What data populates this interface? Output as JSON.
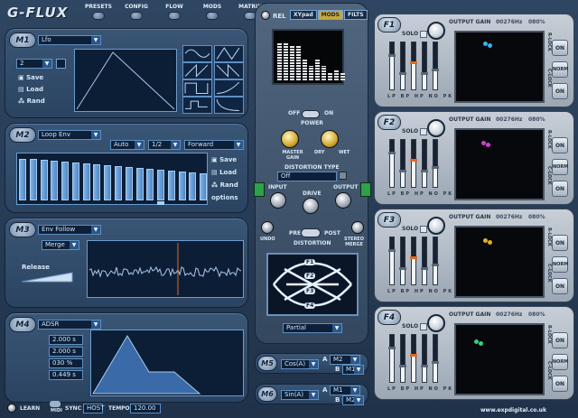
{
  "app": {
    "logo": "G-FLUX",
    "website": "www.expdigital.co.uk"
  },
  "nav": [
    {
      "label": "PRESETS"
    },
    {
      "label": "CONFIG"
    },
    {
      "label": "FLOW"
    },
    {
      "label": "MODS"
    },
    {
      "label": "MATRIX"
    }
  ],
  "m1": {
    "badge": "M1",
    "source": "Lfo",
    "rate": "2",
    "save": "Save",
    "load": "Load",
    "rand": "Rand"
  },
  "m2": {
    "badge": "M2",
    "source": "Loop Env",
    "mode": "Auto",
    "division": "1/2",
    "direction": "Forward",
    "save": "Save",
    "load": "Load",
    "rand": "Rand",
    "options": "options",
    "steps": [
      0.92,
      0.92,
      0.9,
      0.88,
      0.86,
      0.84,
      0.82,
      0.8,
      0.78,
      0.76,
      0.74,
      0.72,
      0.7,
      0.68,
      0.66,
      0.64,
      0.62,
      0.6
    ]
  },
  "m3": {
    "badge": "M3",
    "source": "Env Follow",
    "mode": "Merge",
    "release_label": "Release"
  },
  "m4": {
    "badge": "M4",
    "source": "ADSR",
    "attack": "2.000 s",
    "decay": "2.000 s",
    "sustain": "030 %",
    "release": "0.449 s"
  },
  "m5": {
    "badge": "M5",
    "func": "Cos(A)",
    "a_label": "A",
    "a_value": "M2",
    "b_label": "B",
    "b_value": "M1"
  },
  "m6": {
    "badge": "M6",
    "func": "Sin(A)",
    "a_label": "A",
    "a_value": "M1",
    "b_label": "B",
    "b_value": "M2"
  },
  "center": {
    "rel": "REL",
    "tabs": [
      "XYpad",
      "MODS",
      "FILTS"
    ],
    "off": "OFF",
    "on": "ON",
    "power": "POWER",
    "master_gain": "MASTER GAIN",
    "dry": "DRY",
    "wet": "WET",
    "distortion_type": "DISTORTION TYPE",
    "dist_value": "Off",
    "input": "INPUT",
    "drive": "DRIVE",
    "output": "OUTPUT",
    "undo": "UNDO",
    "pre": "PRE",
    "post": "POST",
    "distortion": "DISTORTION",
    "stereo_merge": "STEREO MERGE",
    "flow_mode": "Partial",
    "filters": [
      "F1",
      "F2",
      "F3",
      "F4"
    ],
    "bars": [
      0.75,
      0.75,
      0.7,
      0.7,
      0.45,
      0.3,
      0.45,
      0.3,
      0.15,
      0.2,
      0.15
    ]
  },
  "filters": [
    {
      "badge": "F1",
      "gain": "OUTPUT GAIN",
      "freq": "00276Hz",
      "pct": "080%",
      "solo": "SOLO",
      "types": [
        "LP",
        "BP",
        "HP",
        "NO",
        "PK"
      ],
      "r": "R-LOCK",
      "c": "C-LOCK",
      "norm": "NORM",
      "on": "ON",
      "dot": "#3fb0e8"
    },
    {
      "badge": "F2",
      "gain": "OUTPUT GAIN",
      "freq": "00276Hz",
      "pct": "080%",
      "solo": "SOLO",
      "types": [
        "LP",
        "BP",
        "HP",
        "NO",
        "PK"
      ],
      "r": "R-LOCK",
      "c": "C-LOCK",
      "norm": "NORM",
      "on": "ON",
      "dot": "#d040c8"
    },
    {
      "badge": "F3",
      "gain": "OUTPUT GAIN",
      "freq": "00276Hz",
      "pct": "080%",
      "solo": "SOLO",
      "types": [
        "LP",
        "BP",
        "HP",
        "NO",
        "PK"
      ],
      "r": "R-LOCK",
      "c": "C-LOCK",
      "norm": "NORM",
      "on": "ON",
      "dot": "#e0b020"
    },
    {
      "badge": "F4",
      "gain": "OUTPUT GAIN",
      "freq": "00276Hz",
      "pct": "080%",
      "solo": "SOLO",
      "types": [
        "LP",
        "BP",
        "HP",
        "NO",
        "PK"
      ],
      "r": "R-LOCK",
      "c": "C-LOCK",
      "norm": "NORM",
      "on": "ON",
      "dot": "#30d080"
    }
  ],
  "footer": {
    "learn": "LEARN",
    "midi": "MIDI",
    "sync": "SYNC",
    "host": "HOST",
    "tempo": "TEMPO",
    "tempo_value": "120.00"
  }
}
